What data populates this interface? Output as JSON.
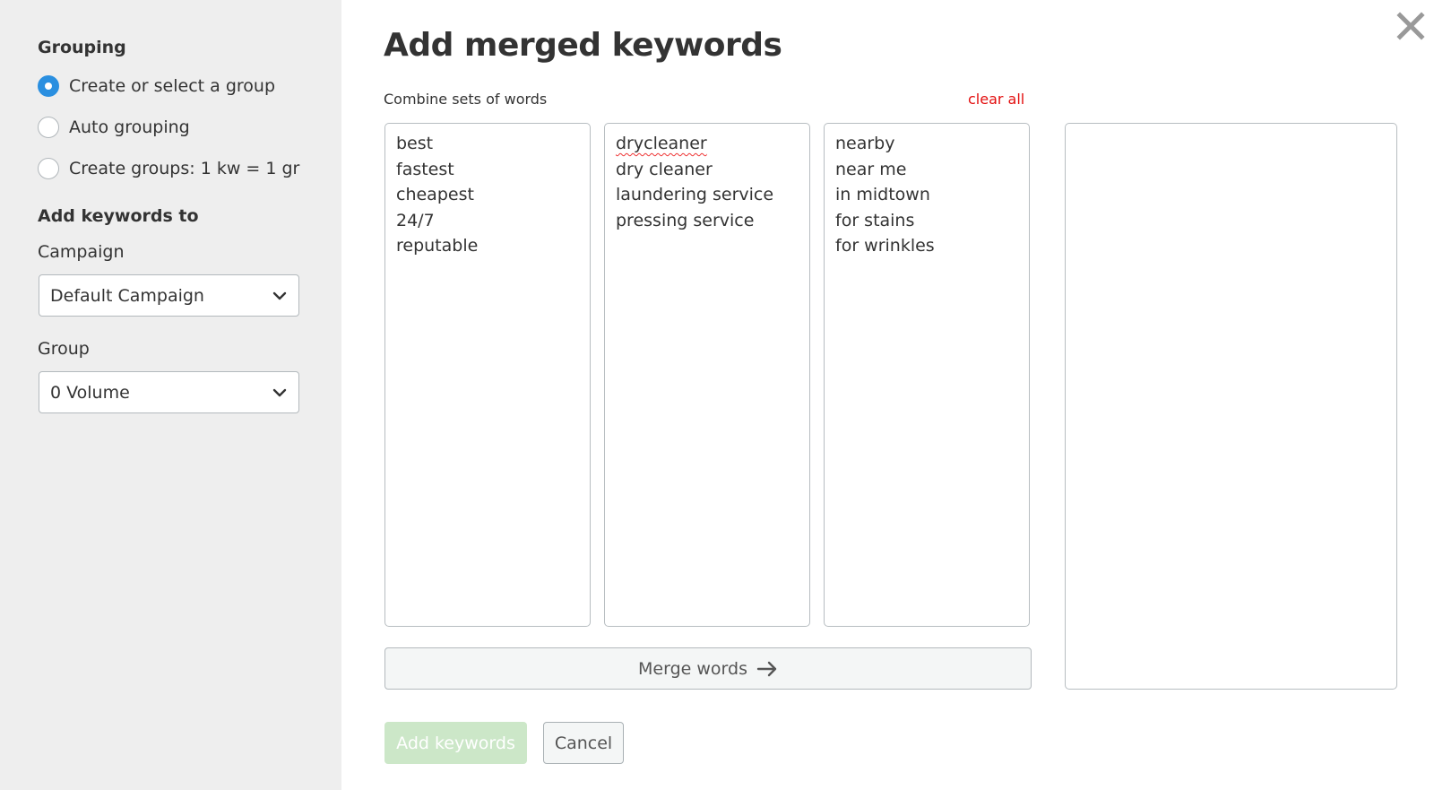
{
  "sidebar": {
    "grouping_heading": "Grouping",
    "grouping_options": [
      {
        "label": "Create or select a group",
        "checked": true
      },
      {
        "label": "Auto grouping",
        "checked": false
      },
      {
        "label": "Create groups: 1 kw = 1 gr",
        "checked": false
      }
    ],
    "add_to_heading": "Add keywords to",
    "campaign_label": "Campaign",
    "campaign_value": "Default Campaign",
    "group_label": "Group",
    "group_value": "0 Volume"
  },
  "main": {
    "title": "Add merged keywords",
    "combine_label": "Combine sets of words",
    "clear_all_label": "clear all",
    "word_sets": [
      [
        "best",
        "fastest",
        "cheapest",
        "24/7",
        "reputable"
      ],
      [
        "drycleaner",
        "dry cleaner",
        "laundering service",
        "pressing service"
      ],
      [
        "nearby",
        "near me",
        "in midtown",
        "for stains",
        "for wrinkles"
      ]
    ],
    "misspelled": [
      "drycleaner"
    ],
    "result_value": "",
    "merge_button_label": "Merge words",
    "add_keywords_label": "Add keywords",
    "cancel_label": "Cancel"
  },
  "icons": {
    "close": "close-icon",
    "merge_arrow": "arrow-right-icon",
    "dropdown": "chevron-down-icon"
  },
  "colors": {
    "accent_blue": "#2a8fe0",
    "clear_all_red": "#e30f0f",
    "add_button_disabled_green": "#cce7c8",
    "sidebar_bg": "#eeeeee"
  }
}
